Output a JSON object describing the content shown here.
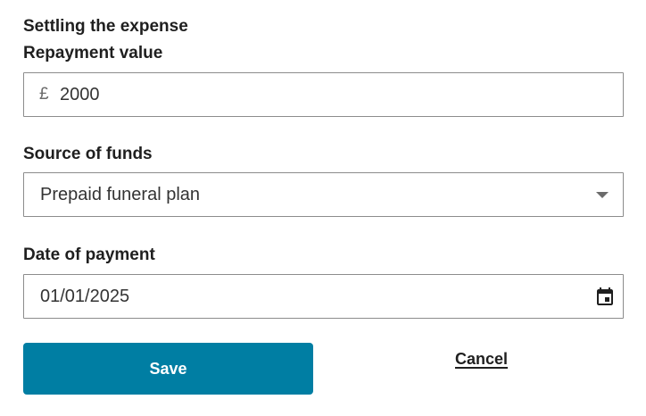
{
  "form": {
    "section_title": "Settling the expense",
    "repayment": {
      "label": "Repayment value",
      "currency_symbol": "£",
      "value": "2000"
    },
    "source": {
      "label": "Source of funds",
      "selected": "Prepaid funeral plan",
      "icon": "chevron-down-icon"
    },
    "date": {
      "label": "Date of payment",
      "value": "01/01/2025",
      "icon": "calendar-icon"
    },
    "save_label": "Save",
    "cancel_label": "Cancel"
  },
  "colors": {
    "primary": "#007ea3",
    "text": "#1f1f1f",
    "border": "#8c8c8c"
  }
}
